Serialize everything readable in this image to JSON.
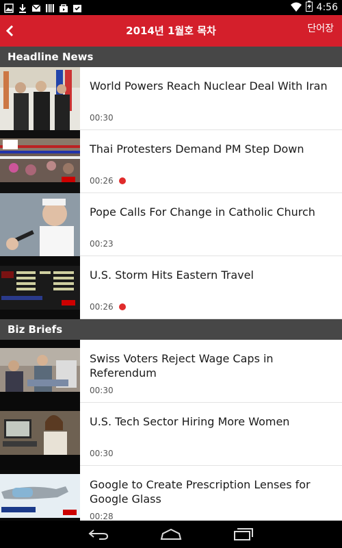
{
  "status_bar": {
    "time": "4:56",
    "left_icons": [
      "image-icon",
      "download-icon",
      "gmail-icon",
      "barcode-icon",
      "shopping-bag-icon",
      "clipboard-check-icon"
    ],
    "right_icons": [
      "wifi-icon",
      "battery-charging-icon"
    ]
  },
  "app_bar": {
    "title": "2014년 1월호 목차",
    "back_icon": "chevron-left-icon",
    "vocab_label": "단어장",
    "color": "#d41f2b"
  },
  "sections": [
    {
      "header": "Headline News",
      "items": [
        {
          "title": "World Powers Reach Nuclear Deal With Iran",
          "duration": "00:30",
          "is_new": false
        },
        {
          "title": "Thai Protesters Demand PM Step Down",
          "duration": "00:26",
          "is_new": true
        },
        {
          "title": "Pope Calls For Change in Catholic Church",
          "duration": "00:23",
          "is_new": false
        },
        {
          "title": "U.S. Storm Hits Eastern Travel",
          "duration": "00:26",
          "is_new": true
        }
      ]
    },
    {
      "header": "Biz Briefs",
      "items": [
        {
          "title": "Swiss Voters Reject Wage Caps in Referendum",
          "duration": "00:30",
          "is_new": false
        },
        {
          "title": "U.S. Tech Sector Hiring More Women",
          "duration": "00:30",
          "is_new": false
        },
        {
          "title": "Google to Create Prescription Lenses for Google Glass",
          "duration": "00:28",
          "is_new": false
        }
      ]
    }
  ],
  "nav_bar": {
    "buttons": [
      "back-icon",
      "home-icon",
      "recent-apps-icon"
    ]
  }
}
